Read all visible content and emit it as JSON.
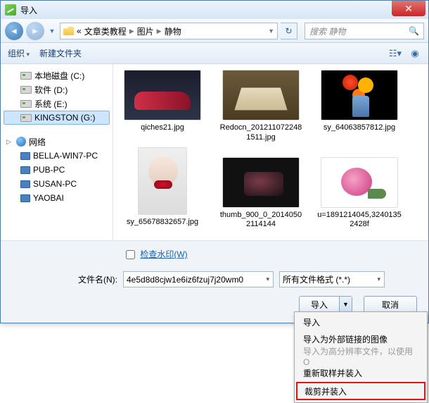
{
  "title": "导入",
  "breadcrumb": {
    "seg1": "文章类教程",
    "seg2": "图片",
    "seg3": "静物"
  },
  "search_placeholder": "搜索 静物",
  "toolbar": {
    "organize": "组织",
    "new_folder": "新建文件夹"
  },
  "sidebar": {
    "drives": [
      {
        "label": "本地磁盘 (C:)"
      },
      {
        "label": "软件 (D:)"
      },
      {
        "label": "系统 (E:)"
      },
      {
        "label": "KINGSTON (G:)"
      }
    ],
    "network_label": "网络",
    "network_pcs": [
      {
        "label": "BELLA-WIN7-PC"
      },
      {
        "label": "PUB-PC"
      },
      {
        "label": "SUSAN-PC"
      },
      {
        "label": "YAOBAI"
      }
    ]
  },
  "files": [
    {
      "name": "qiches21.jpg"
    },
    {
      "name": "Redocn_20121107224815​11.jpg"
    },
    {
      "name": "sy_64063857812.jpg"
    },
    {
      "name": "sy_65678832657.jpg"
    },
    {
      "name": "thumb_900_0_20140502114144"
    },
    {
      "name": "u=1891214045,324013524​28f"
    }
  ],
  "watermark_label": "检查水印(W)",
  "filename_label": "文件名(N):",
  "filename_value": "4e5d8d8cjw1e6iz6fzuj7j20wm0",
  "filter_value": "所有文件格式 (*.*)",
  "buttons": {
    "import": "导入",
    "cancel": "取消"
  },
  "menu": {
    "item1": "导入",
    "item2": "导入为外部链接的图像",
    "item3": "导入为高分辨率文件，以使用 O",
    "item4": "重新取样并装入",
    "item5": "裁剪并装入"
  }
}
